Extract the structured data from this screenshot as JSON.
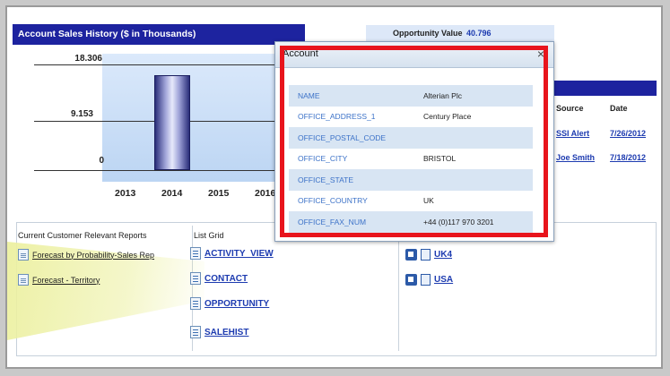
{
  "sales": {
    "title": "Account Sales History ($ in Thousands)",
    "y_ticks": [
      "18.306",
      "9.153",
      "0"
    ],
    "x_ticks": [
      "2013",
      "2014",
      "2015",
      "2016"
    ]
  },
  "chart_data": {
    "type": "bar",
    "title": "Account Sales History ($ in Thousands)",
    "categories": [
      "2013",
      "2014",
      "2015",
      "2016"
    ],
    "values": [
      0,
      16.5,
      0,
      0
    ],
    "ylim": [
      0,
      18.306
    ],
    "y_ticks": [
      18.306,
      9.153,
      0
    ],
    "grid": true
  },
  "opportunity": {
    "label": "Opportunity Value",
    "value": "40.796"
  },
  "related": {
    "columns": [
      "Source",
      "Date"
    ],
    "rows": [
      {
        "source": "SSI Alert",
        "date": "7/26/2012"
      },
      {
        "source": "Joe Smith",
        "date": "7/18/2012"
      }
    ]
  },
  "reports": {
    "title": "Current Customer Relevant Reports",
    "items": [
      "Forecast by Probability-Sales Rep",
      "Forecast - Territory"
    ]
  },
  "list_grid": {
    "title": "List Grid",
    "items": [
      "ACTIVITY_VIEW",
      "CONTACT",
      "OPPORTUNITY",
      "SALEHIST"
    ]
  },
  "favorites": {
    "items": [
      "UK4",
      "USA"
    ]
  },
  "popup": {
    "title": "Account",
    "close": "×",
    "rows": [
      {
        "key": "NAME",
        "value": "Alterian Plc"
      },
      {
        "key": "OFFICE_ADDRESS_1",
        "value": "Century Place"
      },
      {
        "key": "OFFICE_POSTAL_CODE",
        "value": ""
      },
      {
        "key": "OFFICE_CITY",
        "value": "BRISTOL"
      },
      {
        "key": "OFFICE_STATE",
        "value": ""
      },
      {
        "key": "OFFICE_COUNTRY",
        "value": "UK"
      },
      {
        "key": "OFFICE_FAX_NUM",
        "value": "+44 (0)117 970 3201"
      }
    ]
  },
  "colors": {
    "header_blue": "#1d239f",
    "highlight_red": "#e8141c",
    "link_blue": "#1d3bb0"
  }
}
